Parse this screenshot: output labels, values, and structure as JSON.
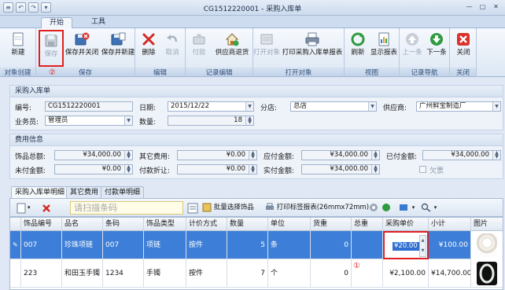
{
  "window": {
    "title": "CG1512220001 - 采购入库单",
    "quick_access": [
      "≡",
      "↶",
      "↷",
      "▾"
    ],
    "controls": [
      "—",
      "▢",
      "✕"
    ]
  },
  "ribbon_tabs": [
    "开始",
    "工具"
  ],
  "ribbon": {
    "groups": [
      {
        "label": "对象创建",
        "buttons": [
          {
            "label": "新建",
            "icon": "new-document-icon"
          }
        ]
      },
      {
        "label": "保存",
        "buttons": [
          {
            "label": "保存",
            "icon": "save-disk-icon",
            "disabled": true,
            "highlighted": true
          },
          {
            "label": "保存并关闭",
            "icon": "save-close-icon"
          },
          {
            "label": "保存并新建",
            "icon": "save-new-icon"
          }
        ]
      },
      {
        "label": "编辑",
        "buttons": [
          {
            "label": "删除",
            "icon": "delete-x-icon"
          },
          {
            "label": "取消",
            "icon": "undo-icon",
            "disabled": true
          }
        ]
      },
      {
        "label": "记录编辑",
        "buttons": [
          {
            "label": "付款",
            "icon": "payment-icon",
            "disabled": true
          },
          {
            "label": "供应商退货",
            "icon": "return-house-icon"
          }
        ]
      },
      {
        "label": "打开对象",
        "buttons": [
          {
            "label": "打开对象",
            "icon": "open-object-icon",
            "disabled": true
          },
          {
            "label": "打印采购入库单报表",
            "icon": "printer-icon"
          }
        ]
      },
      {
        "label": "视图",
        "buttons": [
          {
            "label": "刷新",
            "icon": "refresh-icon"
          },
          {
            "label": "显示报表",
            "icon": "report-icon"
          }
        ]
      },
      {
        "label": "记录导航",
        "buttons": [
          {
            "label": "上一条",
            "icon": "arrow-up-icon",
            "disabled": true
          },
          {
            "label": "下一条",
            "icon": "arrow-down-icon"
          }
        ]
      },
      {
        "label": "关闭",
        "buttons": [
          {
            "label": "关闭",
            "icon": "close-red-icon"
          }
        ]
      }
    ],
    "annotation_save": "②"
  },
  "form": {
    "section_title": "采购入库单",
    "fields": {
      "number": {
        "label": "编号:",
        "value": "CG1512220001"
      },
      "date": {
        "label": "日期:",
        "value": "2015/12/22"
      },
      "store": {
        "label": "分店:",
        "value": "总店"
      },
      "supplier": {
        "label": "供应商:",
        "value": "广州鲜宝制造厂"
      },
      "clerk": {
        "label": "业务员:",
        "value": "管理员"
      },
      "quantity": {
        "label": "数量:",
        "value": "18"
      }
    }
  },
  "fees": {
    "section_title": "费用信息",
    "fields": {
      "jewelry_total": {
        "label": "饰品总额:",
        "value": "¥34,000.00"
      },
      "other_fee": {
        "label": "其它费用:",
        "value": "¥0.00"
      },
      "payable": {
        "label": "应付金额:",
        "value": "¥34,000.00"
      },
      "paid": {
        "label": "已付金额:",
        "value": "¥34,000.00"
      },
      "unpaid": {
        "label": "未付金额:",
        "value": "¥0.00"
      },
      "discount": {
        "label": "付款折让:",
        "value": "¥0.00"
      },
      "actual_paid": {
        "label": "实付金额:",
        "value": "¥34,000.00"
      },
      "owed": {
        "label": "欠票",
        "checked": false
      }
    }
  },
  "detail_tabs": [
    "采购入库单明细",
    "其它费用",
    "付款单明细"
  ],
  "grid_toolbar": {
    "scan_placeholder": "请扫描条码",
    "batch_select": "批量选择饰品",
    "print_labels": "打印标签报表(26mmx72mm)"
  },
  "grid": {
    "columns": [
      "饰品编号",
      "品名",
      "条码",
      "饰品类型",
      "计价方式",
      "数量",
      "单位",
      "货重",
      "总重",
      "采购单价",
      "小计",
      "图片"
    ],
    "rows": [
      {
        "code": "007",
        "name": "珍珠项链",
        "barcode": "007",
        "type": "项链",
        "pricing": "按件",
        "qty": "5",
        "unit": "条",
        "weight": "0",
        "total_weight": "",
        "unit_price": "¥20.00",
        "subtotal": "¥100.00",
        "image": "pearl-necklace"
      },
      {
        "code": "223",
        "name": "和田玉手镯",
        "barcode": "1234",
        "type": "手镯",
        "pricing": "按件",
        "qty": "7",
        "unit": "个",
        "weight": "0",
        "total_weight": "",
        "unit_price": "¥2,100.00",
        "subtotal": "¥14,700.00",
        "image": "jade-bracelet"
      }
    ],
    "annotation_price": "①"
  },
  "colors": {
    "selection": "#3d7fd8",
    "highlight": "#e02020"
  }
}
